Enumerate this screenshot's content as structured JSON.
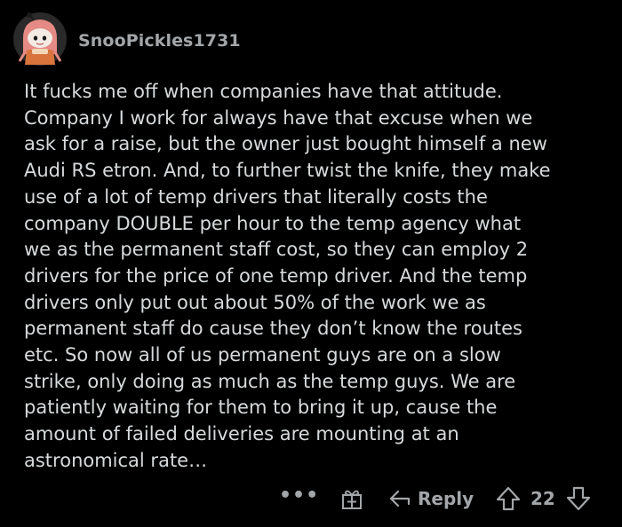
{
  "comment": {
    "username": "SnooPickles1731",
    "body": "It fucks me off when companies have that attitude.\nCompany I work for always have that excuse when we\nask for a raise, but the owner just bought himself a new\nAudi RS etron. And, to further twist the knife, they make\nuse of a lot of temp drivers that literally costs the\ncompany DOUBLE per hour to the temp agency what\nwe as the permanent staff cost, so they can employ 2\ndrivers for the price of one temp driver. And the temp\ndrivers only put out about 50% of the work we as\npermanent staff do cause they don’t know the routes\netc. So now all of us permanent guys are on a slow\nstrike, only doing as much as the temp guys. We are\npatiently waiting for them to bring it up, cause the\namount of failed deliveries are mounting at an\nastronomical rate…"
  },
  "actions": {
    "more_label": "•••",
    "reply_label": "Reply",
    "score": "22"
  },
  "icons": {
    "avatar": "snoo-avatar-icon",
    "more": "more-options-icon",
    "award": "award-gift-icon",
    "reply": "reply-arrow-icon",
    "upvote": "upvote-arrow-icon",
    "downvote": "downvote-arrow-icon"
  },
  "colors": {
    "background": "#000000",
    "text": "#d7dadc",
    "muted": "#a3a6a9"
  }
}
